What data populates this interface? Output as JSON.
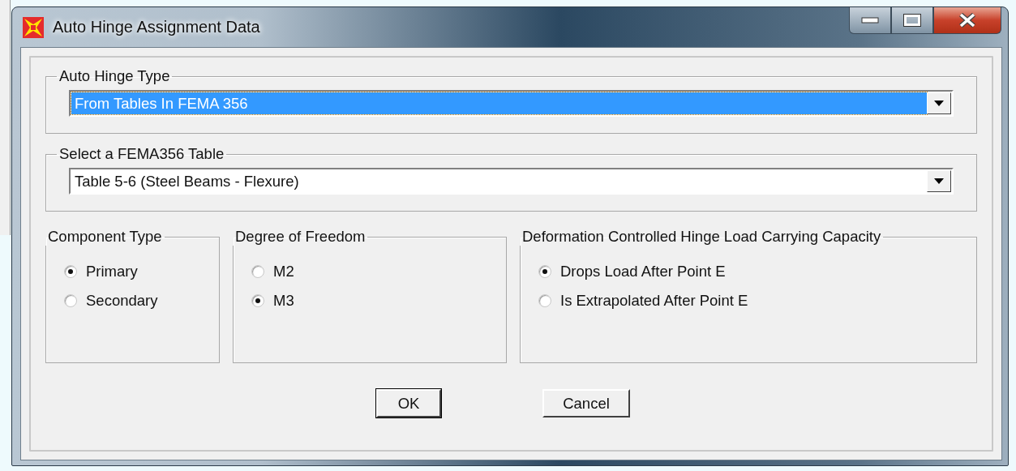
{
  "window": {
    "title": "Auto Hinge Assignment Data"
  },
  "dropdowns": [
    {
      "label": "Auto Hinge Type",
      "value": "From Tables In FEMA 356",
      "focused": true
    },
    {
      "label": "Select a FEMA356 Table",
      "value": "Table 5-6 (Steel Beams - Flexure)",
      "focused": false
    }
  ],
  "radio_groups": [
    {
      "label": "Component Type",
      "options": [
        {
          "label": "Primary",
          "selected": true
        },
        {
          "label": "Secondary",
          "selected": false
        }
      ]
    },
    {
      "label": "Degree of Freedom",
      "options": [
        {
          "label": "M2",
          "selected": false
        },
        {
          "label": "M3",
          "selected": true
        }
      ]
    },
    {
      "label": "Deformation Controlled Hinge Load Carrying Capacity",
      "options": [
        {
          "label": "Drops Load After Point E",
          "selected": true
        },
        {
          "label": "Is Extrapolated After Point E",
          "selected": false
        }
      ]
    }
  ],
  "buttons": [
    {
      "label": "OK",
      "default": true
    },
    {
      "label": "Cancel",
      "default": false
    }
  ]
}
